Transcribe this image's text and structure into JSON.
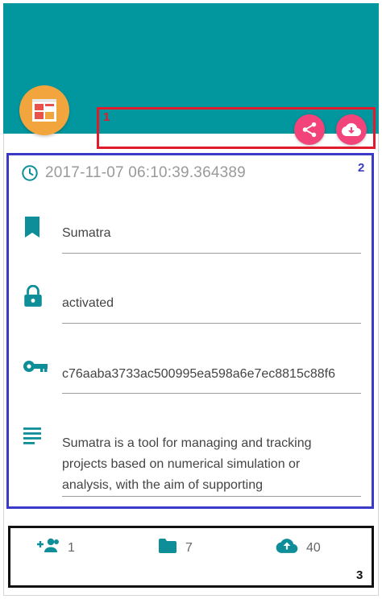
{
  "colors": {
    "banner": "#02969e",
    "accent_icon": "#0e8e98",
    "fab": "#f2447b",
    "avatar_bg": "#f2a53c",
    "annotation_1": "#e21b2c",
    "annotation_2": "#3a39c8",
    "annotation_3": "#111111"
  },
  "header": {
    "avatar_icon": "newspaper-icon",
    "actions": [
      {
        "name": "share",
        "icon": "share-icon"
      },
      {
        "name": "download",
        "icon": "cloud-download-icon"
      }
    ]
  },
  "details": {
    "timestamp": "2017-11-07 06:10:39.364389",
    "name": "Sumatra",
    "status": "activated",
    "key": "c76aaba3733ac500995ea598a6e7ec8815c88f6",
    "description": "Sumatra is a tool for managing and tracking projects based on numerical simulation or analysis, with the aim of supporting"
  },
  "stats": {
    "members": "1",
    "folders": "7",
    "uploads": "40"
  },
  "annotations": {
    "label_1": "1",
    "label_2": "2",
    "label_3": "3"
  }
}
